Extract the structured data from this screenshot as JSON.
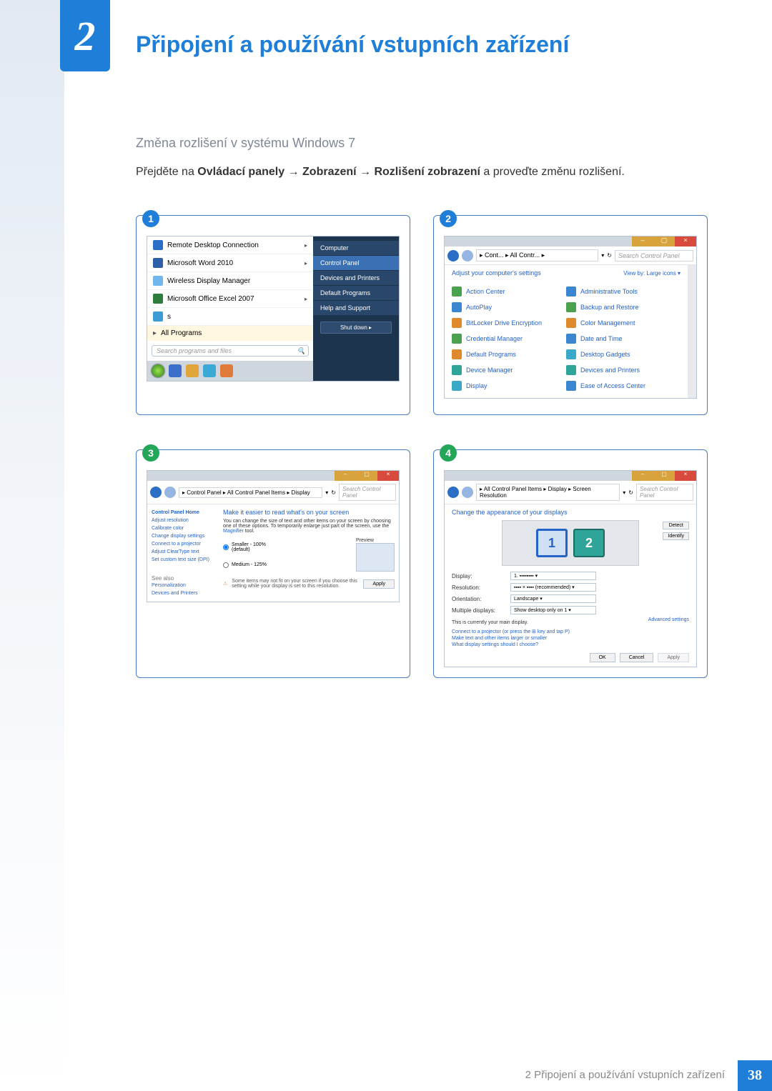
{
  "chapter": {
    "number": "2",
    "title": "Připojení a používání vstupních zařízení"
  },
  "subheading": "Změna rozlišení v systému Windows 7",
  "instruction": {
    "pre": "Přejděte na ",
    "cp": "Ovládací panely",
    "arrow": " → ",
    "disp": "Zobrazení",
    "res": "Rozlišení zobrazení",
    "post": " a proveďte změnu rozlišení."
  },
  "steps": {
    "s1": "1",
    "s2": "2",
    "s3": "3",
    "s4": "4"
  },
  "startmenu": {
    "items": [
      "Remote Desktop Connection",
      "Microsoft Word 2010",
      "Wireless Display Manager",
      "Microsoft Office Excel 2007",
      "s"
    ],
    "all_programs": "All Programs",
    "search_placeholder": "Search programs and files",
    "right": {
      "computer": "Computer",
      "control_panel": "Control Panel",
      "devices": "Devices and Printers",
      "defaults": "Default Programs",
      "help": "Help and Support",
      "shutdown": "Shut down"
    }
  },
  "cp": {
    "path": "▸ Cont... ▸ All Contr... ▸",
    "search_ph": "Search Control Panel",
    "heading": "Adjust your computer's settings",
    "viewby": "View by:   Large icons ▾",
    "left": [
      "Action Center",
      "AutoPlay",
      "BitLocker Drive Encryption",
      "Credential Manager",
      "Default Programs",
      "Device Manager",
      "Display"
    ],
    "right": [
      "Administrative Tools",
      "Backup and Restore",
      "Color Management",
      "Date and Time",
      "Desktop Gadgets",
      "Devices and Printers",
      "Ease of Access Center"
    ]
  },
  "ds": {
    "path": "▸ Control Panel ▸ All Control Panel Items ▸ Display",
    "search_ph": "Search Control Panel",
    "home": "Control Panel Home",
    "links": [
      "Adjust resolution",
      "Calibrate color",
      "Change display settings",
      "Connect to a projector",
      "Adjust ClearType text",
      "Set custom text size (DPI)"
    ],
    "see": "See also",
    "see_links": [
      "Personalization",
      "Devices and Printers"
    ],
    "title": "Make it easier to read what's on your screen",
    "body": "You can change the size of text and other items on your screen by choosing one of these options. To temporarily enlarge just part of the screen, use the ",
    "magnifier": "Magnifier",
    "tool": " tool.",
    "opt1": "Smaller - 100% (default)",
    "preview": "Preview",
    "opt2": "Medium - 125%",
    "warn": "Some items may not fit on your screen if you choose this setting while your display is set to this resolution.",
    "apply": "Apply"
  },
  "sr": {
    "path": "▸ All Control Panel Items ▸ Display ▸ Screen Resolution",
    "search_ph": "Search Control Panel",
    "title": "Change the appearance of your displays",
    "detect": "Detect",
    "identify": "Identify",
    "mon1": "1",
    "mon2": "2",
    "display_l": "Display:",
    "display_v": "1. ▪▪▪▪▪▪▪▪ ▾",
    "res_l": "Resolution:",
    "res_v": "▪▪▪▪ × ▪▪▪▪ (recommended) ▾",
    "ori_l": "Orientation:",
    "ori_v": "Landscape ▾",
    "multi_l": "Multiple displays:",
    "multi_v": "Show desktop only on 1 ▾",
    "main_note": "This is currently your main display.",
    "adv": "Advanced settings",
    "proj": "Connect to a projector (or press the ⊞ key and tap P)",
    "larger": "Make text and other items larger or smaller",
    "what": "What display settings should I choose?",
    "ok": "OK",
    "cancel": "Cancel",
    "apply": "Apply"
  },
  "footer": {
    "label": "2 Připojení a používání vstupních zařízení",
    "page": "38"
  }
}
